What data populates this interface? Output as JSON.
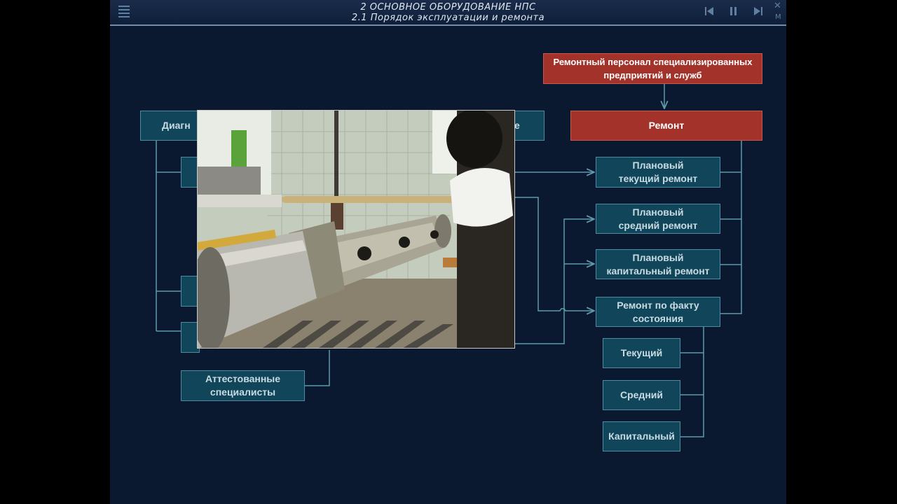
{
  "header": {
    "title": "2  ОСНОВНОЕ ОБОРУДОВАНИЕ НПС",
    "subtitle": "2.1  Порядок эксплуатации и ремонта",
    "close_glyph": "✕",
    "m_label": "M"
  },
  "boxes": {
    "personnel": "Ремонтный персонал специализированных предприятий и служб",
    "repair": "Ремонт",
    "diag_partial": "Диагн",
    "right_partial_e": "е",
    "planned_current": "Плановый текущий ремонт",
    "planned_medium": "Плановый средний ремонт",
    "planned_capital": "Плановый капитальный ремонт",
    "condition_based": "Ремонт по факту состояния",
    "current": "Текущий",
    "medium": "Средний",
    "capital": "Капитальный",
    "certified": "Аттестованные специалисты"
  },
  "colors": {
    "background": "#0b1930",
    "teal_box": "#10455a",
    "red_box": "#a3322a",
    "connector": "#5d9aae"
  }
}
